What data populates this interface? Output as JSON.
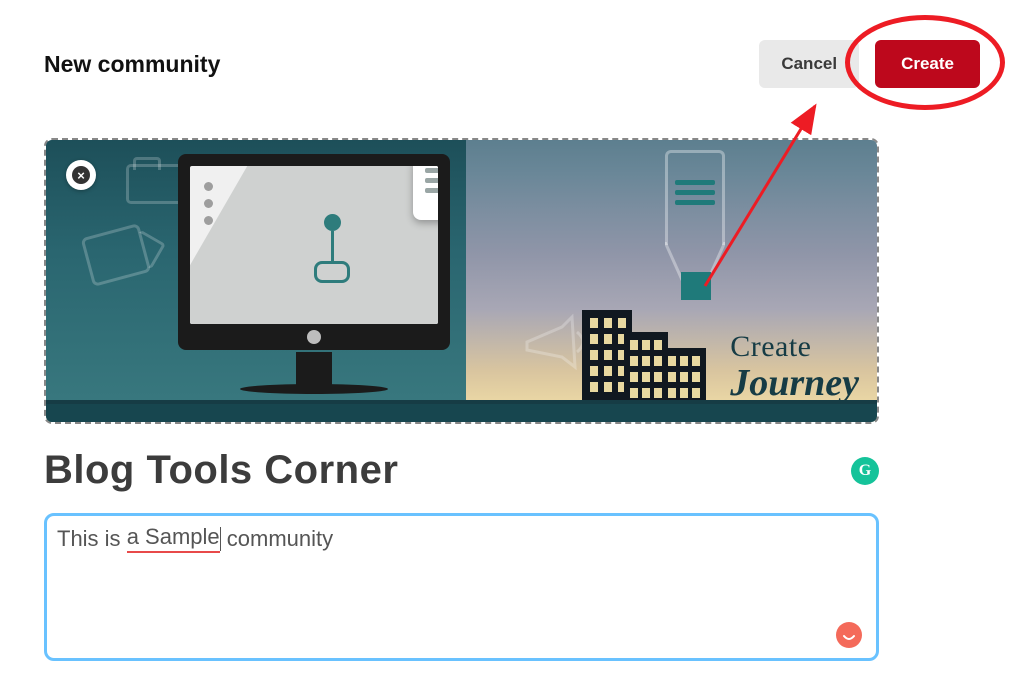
{
  "header": {
    "title": "New community",
    "cancel_label": "Cancel",
    "create_label": "Create"
  },
  "banner": {
    "close_icon_glyph": "×",
    "journey_line1": "Create",
    "journey_line2": "Journey"
  },
  "community": {
    "name": "Blog Tools Corner",
    "description_prefix": "This is ",
    "description_spellerror": "a Sample",
    "description_suffix": " community"
  },
  "grammarly": {
    "glyph": "G"
  },
  "colors": {
    "create_bg": "#bd081c",
    "cancel_bg": "#e9e9e9",
    "focus_border": "#69c2ff",
    "annotation_red": "#ed1c24",
    "grammarly_green": "#15c39a",
    "warn_icon": "#f46a5a"
  }
}
